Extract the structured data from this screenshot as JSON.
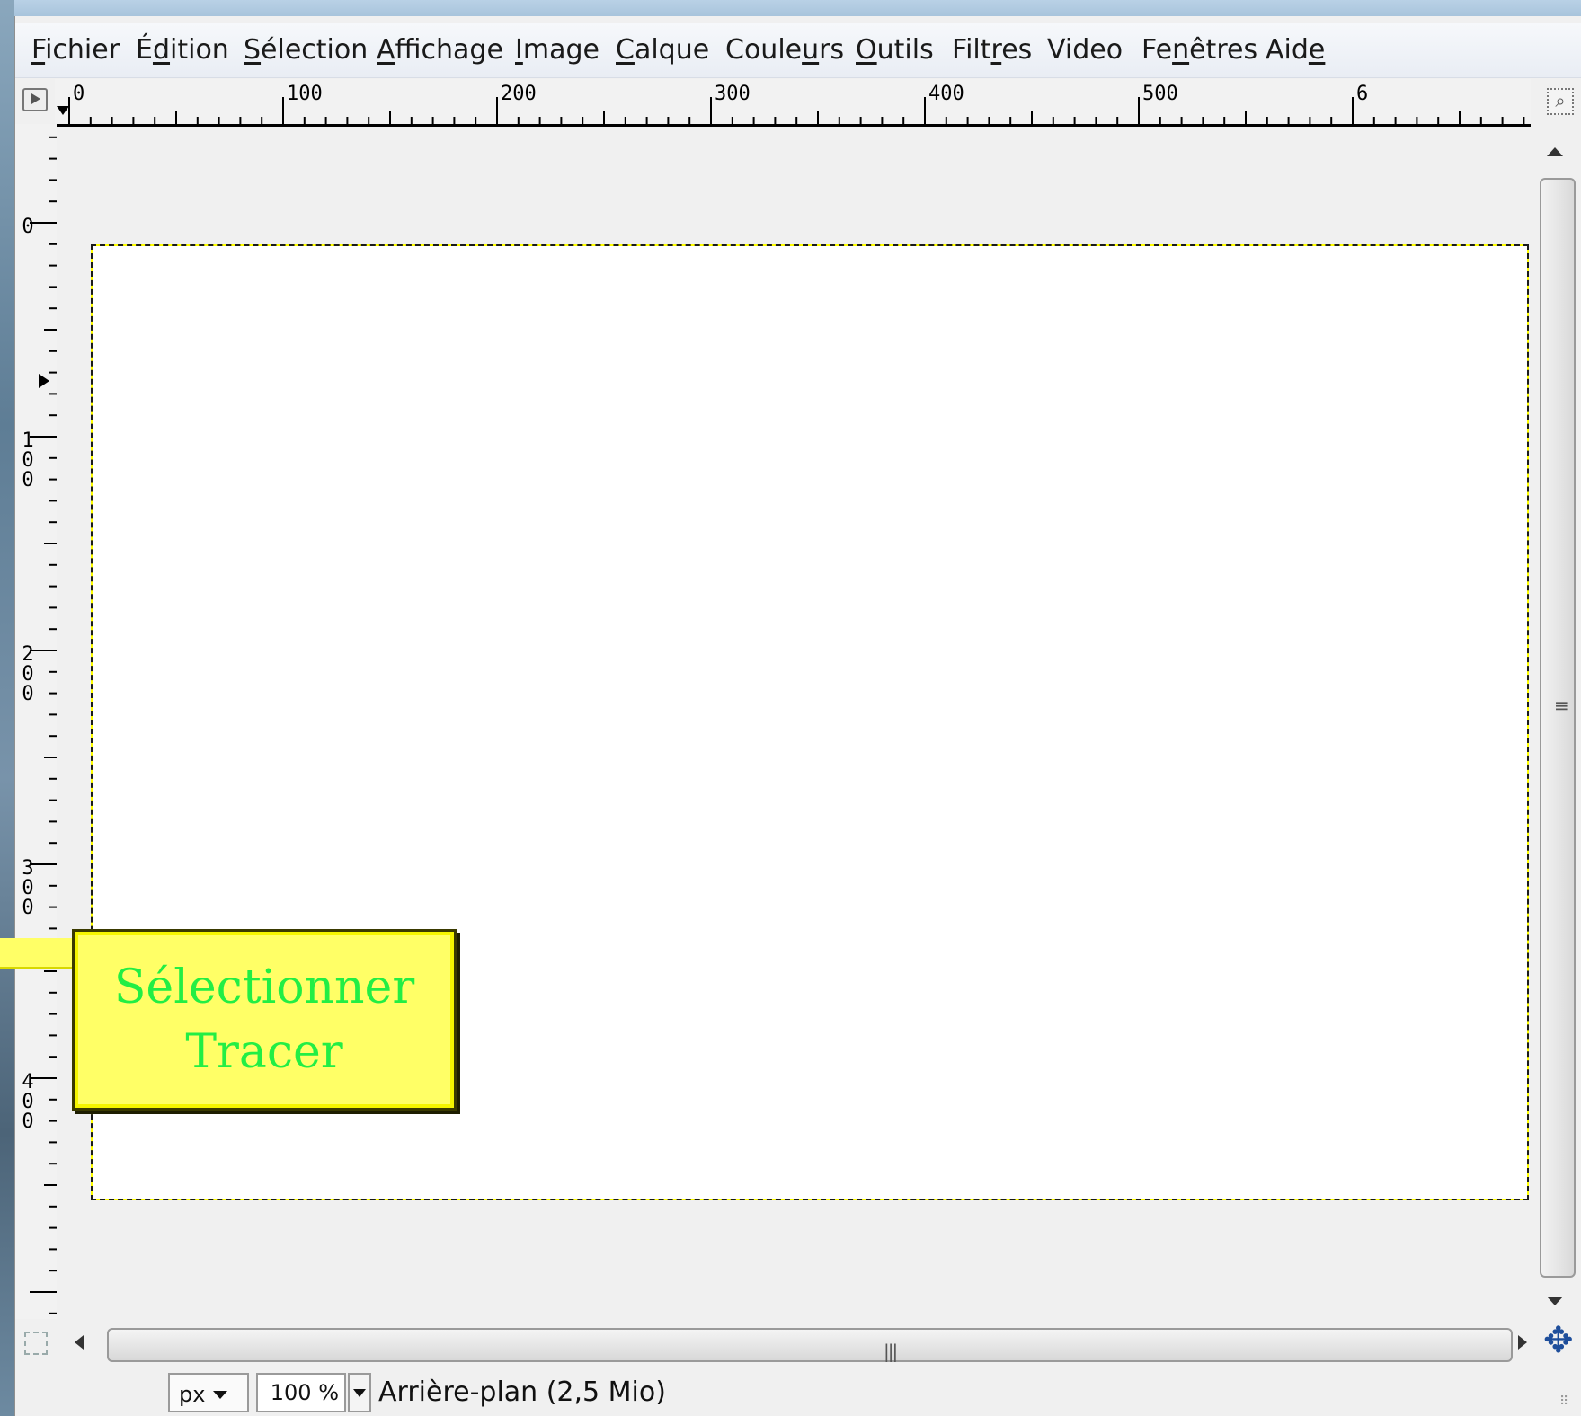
{
  "menu": {
    "items": [
      {
        "pre": "",
        "u": "F",
        "post": "ichier"
      },
      {
        "pre": "É",
        "u": "d",
        "post": "ition"
      },
      {
        "pre": "",
        "u": "S",
        "post": "élection"
      },
      {
        "pre": "",
        "u": "A",
        "post": "ffichage"
      },
      {
        "pre": "",
        "u": "I",
        "post": "mage"
      },
      {
        "pre": "",
        "u": "C",
        "post": "alque"
      },
      {
        "pre": "Coule",
        "u": "u",
        "post": "rs"
      },
      {
        "pre": "",
        "u": "O",
        "post": "utils"
      },
      {
        "pre": "Filt",
        "u": "r",
        "post": "es"
      },
      {
        "pre": "Video",
        "u": "",
        "post": ""
      },
      {
        "pre": "Fe",
        "u": "n",
        "post": "êtres"
      },
      {
        "pre": "Aid",
        "u": "e",
        "post": ""
      }
    ]
  },
  "rulers": {
    "horizontal_labels": [
      "0",
      "100",
      "200",
      "300",
      "400",
      "500",
      "6"
    ],
    "vertical_labels": [
      [
        "0"
      ],
      [
        "1",
        "0",
        "0"
      ],
      [
        "2",
        "0",
        "0"
      ],
      [
        "3",
        "0",
        "0"
      ],
      [
        "4",
        "0",
        "0"
      ]
    ]
  },
  "statusbar": {
    "unit": "px",
    "zoom": "100 %",
    "layer_info": "Arrière-plan (2,5 Mio)"
  },
  "callout": {
    "line1": "Sélectionner",
    "line2": "Tracer"
  },
  "icons": {
    "navigate": "move-arrows-icon",
    "zoom_corner": "zoom-icon",
    "quick_mask": "quick-mask-icon",
    "ruler_menu": "menu-arrow-icon"
  },
  "colors": {
    "callout_bg": "#ffff66",
    "callout_text": "#22ee44",
    "selection_dash": "#ffff00"
  }
}
